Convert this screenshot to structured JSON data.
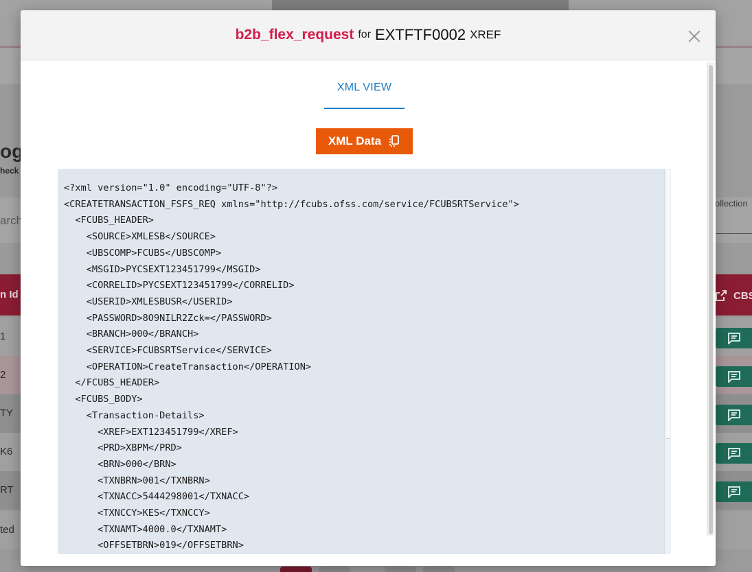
{
  "background": {
    "heading_fragment": "og",
    "subheading_fragment": "heck",
    "search_fragment": "arch",
    "collection_fragment": "ollection",
    "table_header_left": "n Id",
    "table_header_right": "CBS",
    "rows": [
      "1",
      "2",
      "TY",
      "K6",
      "RT",
      "ted"
    ]
  },
  "modal": {
    "title": {
      "name": "b2b_flex_request",
      "for": "for",
      "id": "EXTFTF0002",
      "suffix": "XREF"
    },
    "tab_label": "XML VIEW",
    "xml_button_label": "XML Data",
    "xml_lines": [
      "<?xml version=\"1.0\" encoding=\"UTF-8\"?>",
      "<CREATETRANSACTION_FSFS_REQ xmlns=\"http://fcubs.ofss.com/service/FCUBSRTService\">",
      "  <FCUBS_HEADER>",
      "    <SOURCE>XMLESB</SOURCE>",
      "    <UBSCOMP>FCUBS</UBSCOMP>",
      "    <MSGID>PYCSEXT123451799</MSGID>",
      "    <CORRELID>PYCSEXT123451799</CORRELID>",
      "    <USERID>XMLESBUSR</USERID>",
      "    <PASSWORD>8O9NILR2Zck=</PASSWORD>",
      "    <BRANCH>000</BRANCH>",
      "    <SERVICE>FCUBSRTService</SERVICE>",
      "    <OPERATION>CreateTransaction</OPERATION>",
      "  </FCUBS_HEADER>",
      "  <FCUBS_BODY>",
      "    <Transaction-Details>",
      "      <XREF>EXT123451799</XREF>",
      "      <PRD>XBPM</PRD>",
      "      <BRN>000</BRN>",
      "      <TXNBRN>001</TXNBRN>",
      "      <TXNACC>5444298001</TXNACC>",
      "      <TXNCCY>KES</TXNCCY>",
      "      <TXNAMT>4000.0</TXNAMT>",
      "      <OFFSETBRN>019</OFFSETBRN>"
    ]
  },
  "icons": {
    "close": "close-icon",
    "copy": "copy-icon",
    "chat": "chat-icon",
    "external": "external-link-icon"
  },
  "colors": {
    "title_accent": "#d21e4a",
    "tab_active": "#1e7dc8",
    "xml_button": "#e9590a",
    "code_background": "#e1e7ef"
  }
}
